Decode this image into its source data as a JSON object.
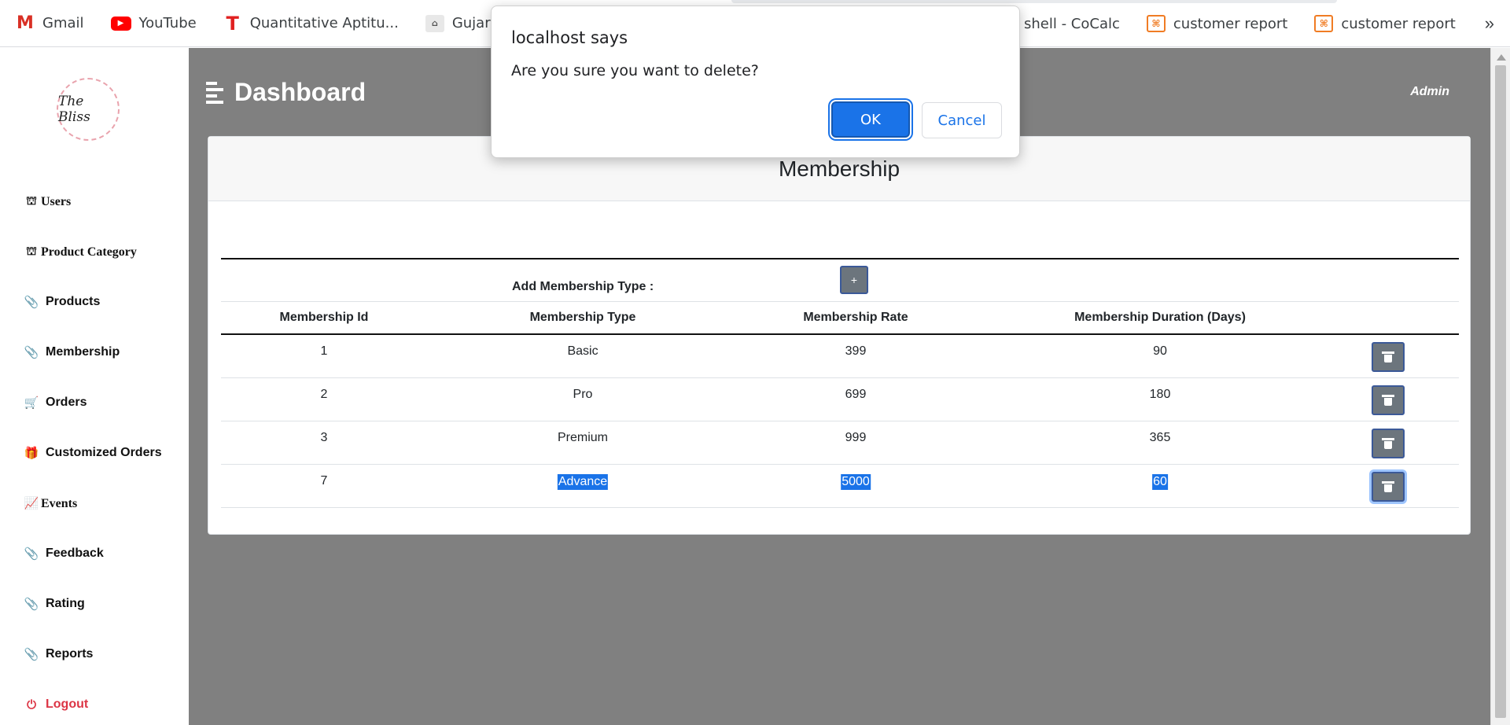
{
  "bookmarks": {
    "items": [
      {
        "label": "Gmail",
        "icon": "gmail-icon",
        "glyph": "M"
      },
      {
        "label": "YouTube",
        "icon": "youtube-icon",
        "glyph": "▶"
      },
      {
        "label": "Quantitative Aptitu...",
        "icon": "t-logo-icon",
        "glyph": "T"
      },
      {
        "label": "Gujarat Unive",
        "icon": "university-icon",
        "glyph": "⌂"
      }
    ],
    "right_items": [
      {
        "label": "shell - CoCalc"
      },
      {
        "label": "customer report",
        "icon": "xampp-icon",
        "glyph": "⌘"
      },
      {
        "label": "customer report",
        "icon": "xampp-icon",
        "glyph": "⌘"
      }
    ],
    "more": "»"
  },
  "sidebar": {
    "logo_text": "The Bliss",
    "items": [
      {
        "label": "Users",
        "icon": "sitemap-icon",
        "glyph": "⛫"
      },
      {
        "label": "Product Category",
        "icon": "sitemap-icon",
        "glyph": "⛫"
      },
      {
        "label": "Products",
        "icon": "paperclip-icon",
        "glyph": "📎"
      },
      {
        "label": "Membership",
        "icon": "paperclip-icon",
        "glyph": "📎"
      },
      {
        "label": "Orders",
        "icon": "cart-icon",
        "glyph": "🛒"
      },
      {
        "label": "Customized Orders",
        "icon": "gift-icon",
        "glyph": "🎁"
      },
      {
        "label": "Events",
        "icon": "chart-line-icon",
        "glyph": "📈"
      },
      {
        "label": "Feedback",
        "icon": "paperclip-icon",
        "glyph": "📎"
      },
      {
        "label": "Rating",
        "icon": "paperclip-icon",
        "glyph": "📎"
      },
      {
        "label": "Reports",
        "icon": "paperclip-icon",
        "glyph": "📎"
      },
      {
        "label": "Logout",
        "icon": "power-icon",
        "glyph": "⏻"
      }
    ]
  },
  "header": {
    "title": "Dashboard",
    "user": "Admin"
  },
  "card": {
    "title": "Membership",
    "add_label": "Add Membership Type :",
    "add_button": "+",
    "columns": [
      "Membership Id",
      "Membership Type",
      "Membership Rate",
      "Membership Duration (Days)"
    ],
    "rows": [
      {
        "id": "1",
        "type": "Basic",
        "rate": "399",
        "duration": "90"
      },
      {
        "id": "2",
        "type": "Pro",
        "rate": "699",
        "duration": "180"
      },
      {
        "id": "3",
        "type": "Premium",
        "rate": "999",
        "duration": "365"
      },
      {
        "id": "7",
        "type": "Advance",
        "rate": "5000",
        "duration": "60"
      }
    ]
  },
  "dialog": {
    "title": "localhost says",
    "message": "Are you sure you want to delete?",
    "ok": "OK",
    "cancel": "Cancel"
  },
  "colors": {
    "main_bg": "#808080",
    "accent": "#1a73e8",
    "logout": "#dc3545",
    "button_gray": "#6c757d"
  }
}
